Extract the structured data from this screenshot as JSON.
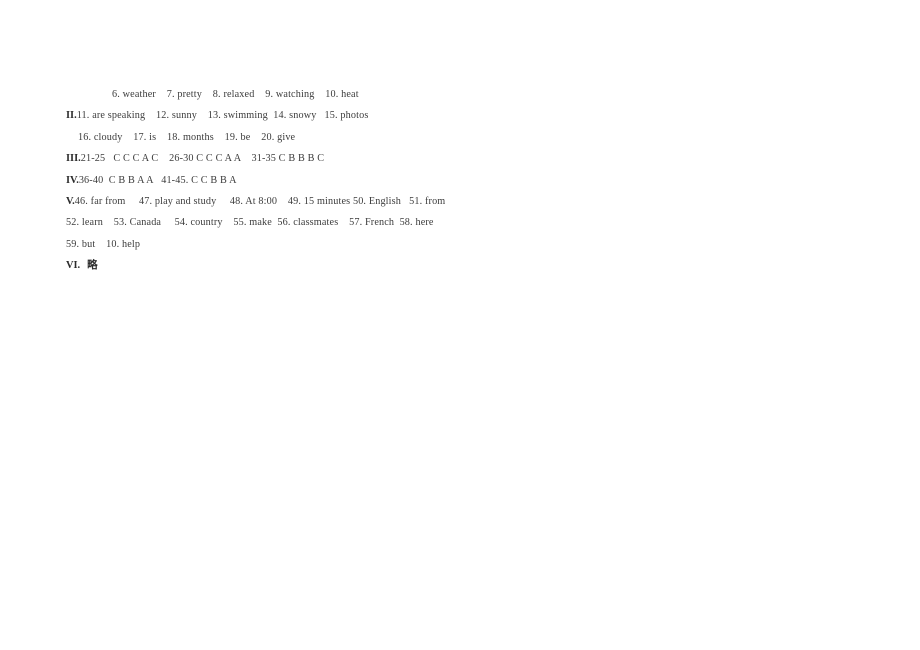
{
  "document": {
    "type": "answer-key",
    "background_color": "#ffffff",
    "text_color": "#3c3c3c",
    "lines": [
      {
        "id": "line-1",
        "marker": "",
        "indent": "big",
        "text": "6. weather    7. pretty    8. relaxed    9. watching    10. heat"
      },
      {
        "id": "line-2",
        "marker": "II.",
        "indent": "none",
        "text": "11. are speaking    12. sunny    13. swimming  14. snowy   15. photos"
      },
      {
        "id": "line-3",
        "marker": "",
        "indent": "small",
        "text": "16. cloudy    17. is    18. months    19. be    20. give"
      },
      {
        "id": "line-4",
        "marker": "III.",
        "indent": "none",
        "text": "21-25   C C C A C    26-30 C C C A A    31-35 C B B B C"
      },
      {
        "id": "line-5",
        "marker": "IV.",
        "indent": "none",
        "text": "36-40  C B B A A   41-45. C C B B A"
      },
      {
        "id": "line-6",
        "marker": "V.",
        "indent": "none",
        "text": "46. far from     47. play and study     48. At 8:00    49. 15 minutes 50. English   51. from"
      },
      {
        "id": "line-7",
        "marker": "",
        "indent": "none",
        "text": "52. learn    53. Canada     54. country    55. make  56. classmates    57. French  58. here"
      },
      {
        "id": "line-8",
        "marker": "",
        "indent": "none",
        "text": "59. but    10. help"
      },
      {
        "id": "line-9",
        "marker": "VI.",
        "indent": "none",
        "text": "略"
      }
    ]
  },
  "sections": {
    "section_2_label": "II.",
    "section_3_label": "III.",
    "section_4_label": "IV.",
    "section_5_label": "V.",
    "section_6_label": "VI."
  },
  "answers": {
    "section_1_continued": [
      {
        "number": "6.",
        "answer": "weather"
      },
      {
        "number": "7.",
        "answer": "pretty"
      },
      {
        "number": "8.",
        "answer": "relaxed"
      },
      {
        "number": "9.",
        "answer": "watching"
      },
      {
        "number": "10.",
        "answer": "heat"
      }
    ],
    "section_2": [
      {
        "number": "11.",
        "answer": "are speaking"
      },
      {
        "number": "12.",
        "answer": "sunny"
      },
      {
        "number": "13.",
        "answer": "swimming"
      },
      {
        "number": "14.",
        "answer": "snowy"
      },
      {
        "number": "15.",
        "answer": "photos"
      },
      {
        "number": "16.",
        "answer": "cloudy"
      },
      {
        "number": "17.",
        "answer": "is"
      },
      {
        "number": "18.",
        "answer": "months"
      },
      {
        "number": "19.",
        "answer": "be"
      },
      {
        "number": "20.",
        "answer": "give"
      }
    ],
    "section_3": [
      {
        "range": "21-25",
        "letters": "C C C A C"
      },
      {
        "range": "26-30",
        "letters": "C C C A A"
      },
      {
        "range": "31-35",
        "letters": "C B B B C"
      }
    ],
    "section_4": [
      {
        "range": "36-40",
        "letters": "C B B A A"
      },
      {
        "range": "41-45.",
        "letters": "C C B B A"
      }
    ],
    "section_5": [
      {
        "number": "46.",
        "answer": "far from"
      },
      {
        "number": "47.",
        "answer": "play and study"
      },
      {
        "number": "48.",
        "answer": "At 8:00"
      },
      {
        "number": "49.",
        "answer": "15 minutes"
      },
      {
        "number": "50.",
        "answer": "English"
      },
      {
        "number": "51.",
        "answer": "from"
      },
      {
        "number": "52.",
        "answer": "learn"
      },
      {
        "number": "53.",
        "answer": "Canada"
      },
      {
        "number": "54.",
        "answer": "country"
      },
      {
        "number": "55.",
        "answer": "make"
      },
      {
        "number": "56.",
        "answer": "classmates"
      },
      {
        "number": "57.",
        "answer": "French"
      },
      {
        "number": "58.",
        "answer": "here"
      },
      {
        "number": "59.",
        "answer": "but"
      },
      {
        "number": "10.",
        "answer": "help"
      }
    ],
    "section_6": {
      "answer": "略"
    }
  }
}
